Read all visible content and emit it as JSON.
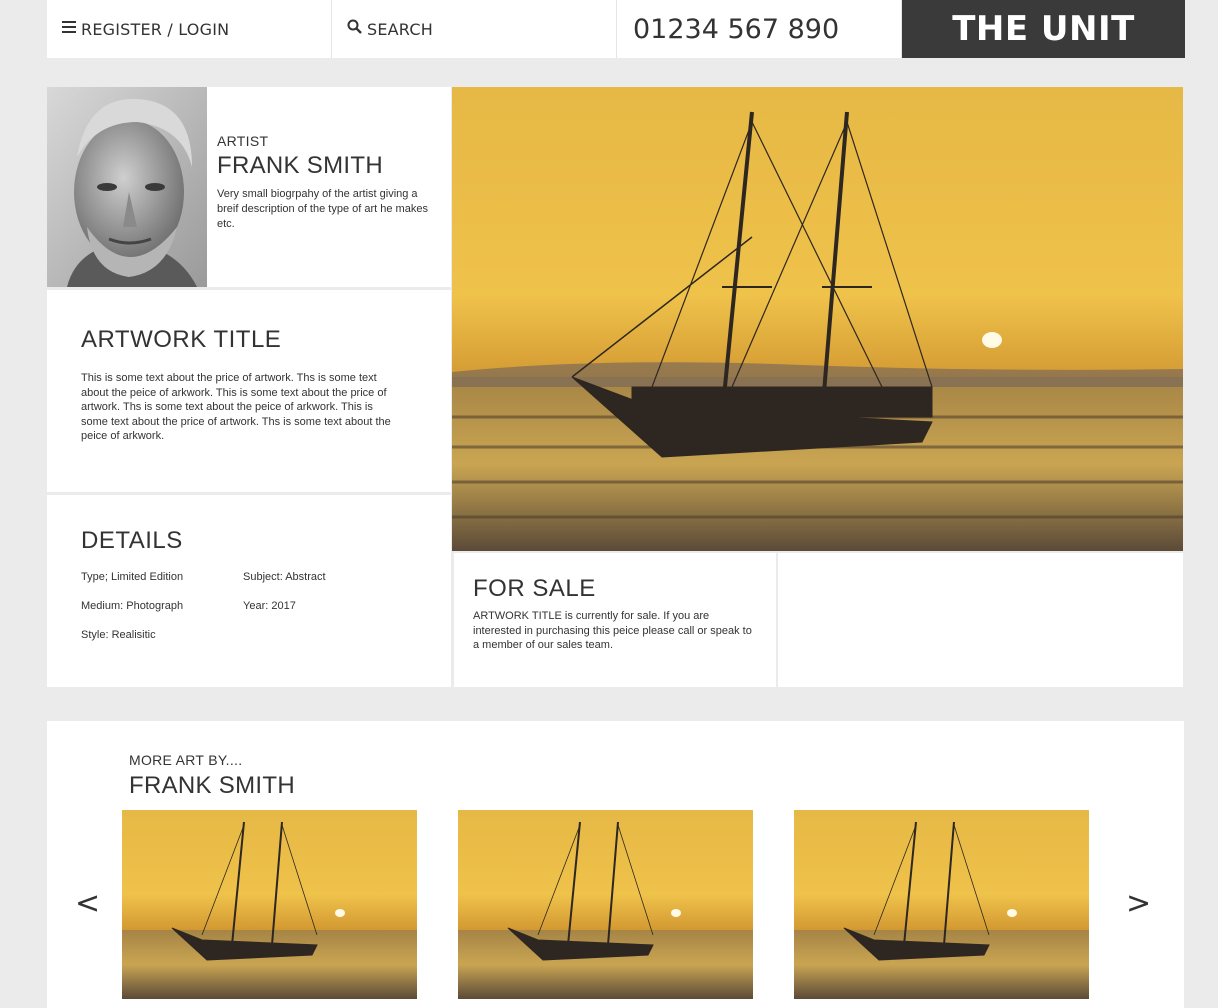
{
  "nav": {
    "login_label": "REGISTER / LOGIN",
    "search_label": "SEARCH",
    "phone": "01234 567 890",
    "brand": "THE UNIT",
    "menu_icon": "hamburger-icon",
    "search_icon": "magnifier-icon"
  },
  "artist": {
    "kicker": "ARTIST",
    "name": "FRANK SMITH",
    "bio": "Very small biogrpahy of the artist giving a breif description of the type of art he makes etc."
  },
  "artwork": {
    "title": "ARTWORK TITLE",
    "description": "This is some text about the price of artwork. Ths is some text about the peice of arkwork. This is some text about the price of artwork. Ths is some text about the peice of arkwork. This is some text about the price of artwork. Ths is some text about the peice of arkwork."
  },
  "details": {
    "heading": "DETAILS",
    "type": "Type; Limited Edition",
    "subject": "Subject: Abstract",
    "medium": "Medium: Photograph",
    "year": "Year: 2017",
    "style": "Style: Realisitic"
  },
  "sale": {
    "heading": "FOR SALE",
    "text": "ARTWORK TITLE is currently for sale. If you are interested in purchasing this peice please call or speak to a member of our sales team."
  },
  "more": {
    "kicker": "MORE ART BY....",
    "name": "FRANK SMITH",
    "prev": "<",
    "next": ">"
  },
  "colors": {
    "background": "#ebebeb",
    "panel": "#ffffff",
    "brand_bg": "#3a3a3a",
    "text": "#333333",
    "sky_gold": "#e6b845"
  }
}
